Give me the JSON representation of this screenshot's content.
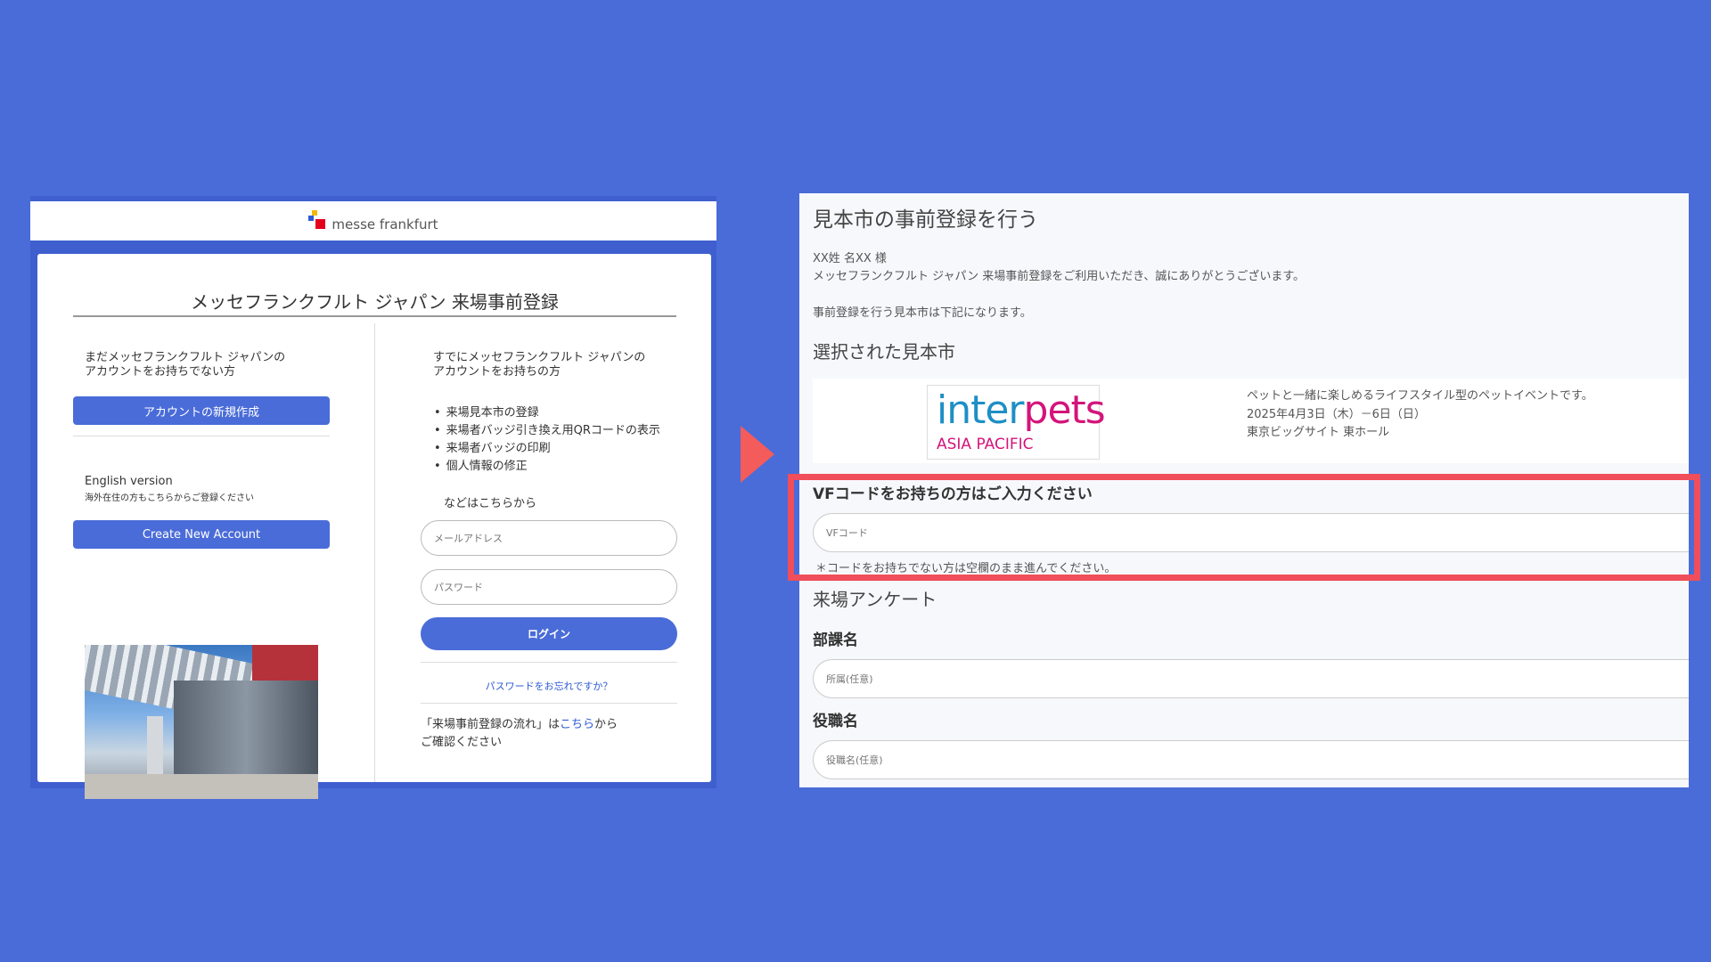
{
  "login_page": {
    "brand": "messe frankfurt",
    "title": "メッセフランクフルト ジャパン 来場事前登録",
    "new_user": {
      "intro_line1": "まだメッセフランクフルト ジャパンの",
      "intro_line2": "アカウントをお持ちでない方",
      "create_button": "アカウントの新規作成",
      "english_title": "English version",
      "english_sub": "海外在住の方もこちらからご登録ください",
      "english_button": "Create New Account"
    },
    "existing_user": {
      "intro_line1": "すでにメッセフランクフルト ジャパンの",
      "intro_line2": "アカウントをお持ちの方",
      "bullets": [
        "来場見本市の登録",
        "来場者バッジ引き換え用QRコードの表示",
        "来場者バッジの印刷",
        "個人情報の修正"
      ],
      "bullets_tail": "などはこちらから",
      "email_placeholder": "メールアドレス",
      "password_placeholder": "パスワード",
      "login_button": "ログイン",
      "forgot_password": "パスワードをお忘れですか？",
      "flow_prefix": "「来場事前登録の流れ」は",
      "flow_link": "こちら",
      "flow_suffix": "から",
      "flow_line2": "ご確認ください"
    }
  },
  "registration": {
    "title": "見本市の事前登録を行う",
    "greeting": "XX姓 名XX 様",
    "thanks": "メッセフランクフルト ジャパン 来場事前登録をご利用いただき、誠にありがとうございます。",
    "lead": "事前登録を行う見本市は下記になります。",
    "selected_heading": "選択された見本市",
    "event": {
      "logo_part1": "inter",
      "logo_part2": "pets",
      "logo_sub": "ASIA PACIFIC",
      "description": "ペットと一緒に楽しめるライフスタイル型のペットイベントです。",
      "dates": "2025年4月3日（木）－6日（日）",
      "venue": "東京ビッグサイト 東ホール"
    },
    "vf_heading": "VFコードをお持ちの方はご入力ください",
    "vf_placeholder": "VFコード",
    "vf_note": "＊コードをお持ちでない方は空欄のまま進んでください。",
    "survey_heading": "来場アンケート",
    "department_label": "部課名",
    "department_placeholder": "所属(任意)",
    "position_label": "役職名",
    "position_placeholder": "役職名(任意)"
  },
  "colors": {
    "background": "#4a6cd8",
    "accent": "#4a6cd8",
    "highlight": "#f04e5a",
    "arrow": "#f45b5b"
  }
}
